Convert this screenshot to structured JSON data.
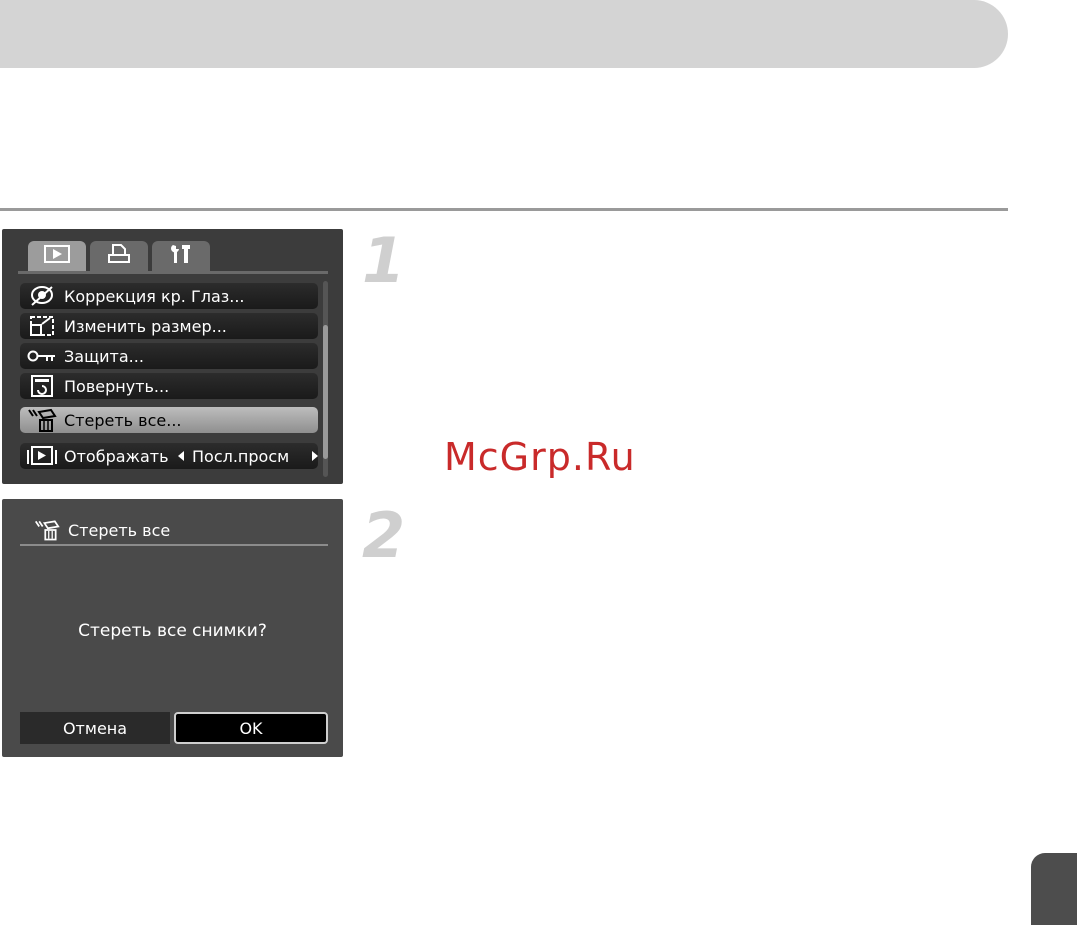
{
  "step1": {
    "number": "1"
  },
  "step2": {
    "number": "2"
  },
  "watermark": "McGrp.Ru",
  "menu": {
    "tabs": [
      {
        "icon": "playback-icon"
      },
      {
        "icon": "print-icon"
      },
      {
        "icon": "settings-icon"
      }
    ],
    "items": [
      {
        "label": "Коррекция кр. Глаз...",
        "icon": "red-eye-icon"
      },
      {
        "label": "Изменить размер...",
        "icon": "resize-icon"
      },
      {
        "label": "Защита...",
        "icon": "key-icon"
      },
      {
        "label": "Повернуть...",
        "icon": "rotate-icon"
      },
      {
        "label": "Стереть все...",
        "icon": "erase-all-icon",
        "selected": true
      },
      {
        "label": "Отображать",
        "icon": "display-icon",
        "value": "Посл.просм"
      }
    ]
  },
  "dialog": {
    "title": "Стереть все",
    "question": "Стереть все снимки?",
    "cancel": "Отмена",
    "ok": "OK"
  },
  "colors": {
    "header_bar": "#d4d4d4",
    "screen_bg": "#3c3c3c",
    "watermark": "#c92a2a",
    "corner_tab": "#4d4d4d"
  }
}
